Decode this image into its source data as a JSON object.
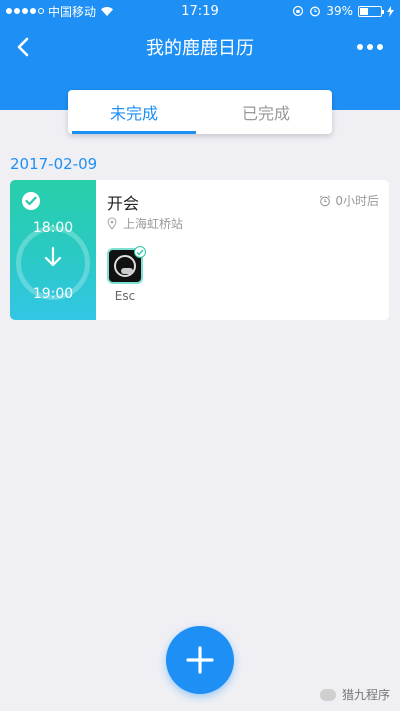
{
  "status_bar": {
    "carrier": "中国移动",
    "time": "17:19",
    "battery_percent": "39%",
    "battery_level": 0.39,
    "icons": [
      "signal-dots-icon",
      "wifi-icon",
      "orientation-lock-icon",
      "alarm-icon",
      "battery-icon",
      "charging-icon"
    ]
  },
  "nav": {
    "title": "我的鹿鹿日历",
    "back_icon": "chevron-left-icon",
    "more_icon": "more-dots-icon"
  },
  "tabs": [
    {
      "label": "未完成",
      "active": true
    },
    {
      "label": "已完成",
      "active": false
    }
  ],
  "events_group": {
    "date": "2017-02-09",
    "events": [
      {
        "title": "开会",
        "start_time": "18:00",
        "end_time": "19:00",
        "reminder": "0小时后",
        "location": "上海虹桥站",
        "participants": [
          {
            "name": "Esc"
          }
        ]
      }
    ]
  },
  "fab": {
    "icon": "plus-icon"
  },
  "colors": {
    "primary": "#1e90f5",
    "teal_start": "#27cfa9",
    "teal_end": "#33c6e6",
    "background": "#efeff4"
  },
  "watermark": {
    "left_text": "",
    "right_text": "猎九程序"
  }
}
